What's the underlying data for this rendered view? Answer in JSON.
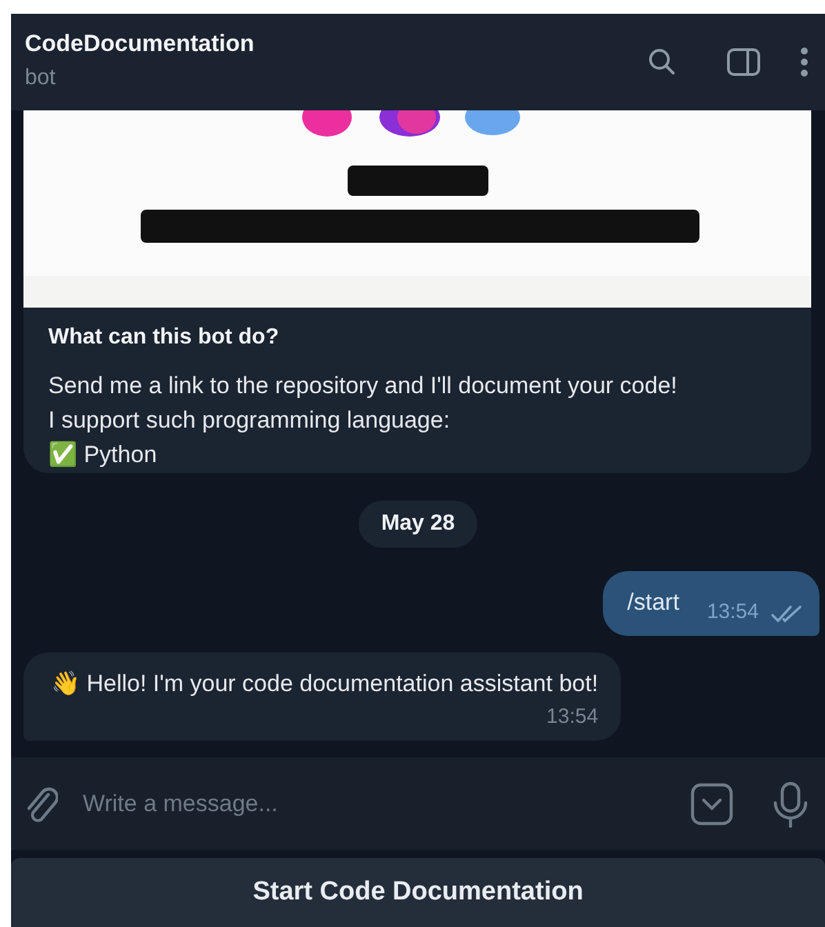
{
  "header": {
    "title": "CodeDocumentation",
    "subtitle": "bot"
  },
  "bot_info": {
    "heading": "What can this bot do?",
    "lines": [
      "Send me a link to the repository and I'll document your code!",
      "I support such programming language:",
      "✅ Python"
    ]
  },
  "date_separator": "May 28",
  "messages": [
    {
      "kind": "outgoing",
      "text": "/start",
      "time": "13:54",
      "read": true
    },
    {
      "kind": "incoming",
      "text": "👋 Hello! I'm your code documentation assistant bot!",
      "time": "13:54"
    }
  ],
  "composer": {
    "placeholder": "Write a message..."
  },
  "keyboard_buttons": [
    "Start Code Documentation"
  ]
}
